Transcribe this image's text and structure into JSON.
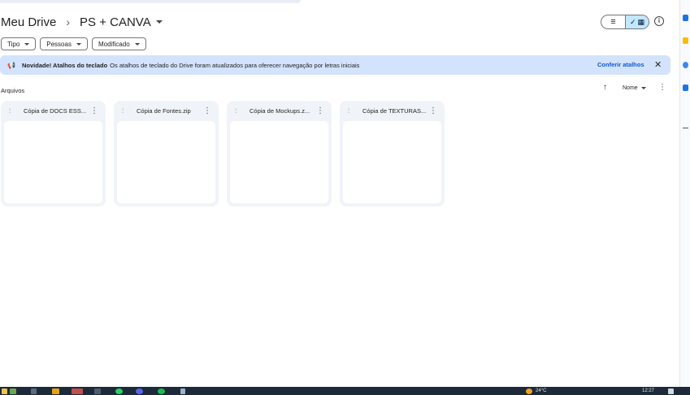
{
  "breadcrumb": {
    "root": "Meu Drive",
    "separator": "›",
    "current": "PS + CANVA"
  },
  "view_toggle": {
    "list_icon": "list-icon",
    "grid_icon": "grid-icon",
    "check_glyph": "✓",
    "list_glyph": "≡",
    "grid_glyph": "▦"
  },
  "info": {
    "glyph": "i"
  },
  "filters": [
    {
      "label": "Tipo"
    },
    {
      "label": "Pessoas"
    },
    {
      "label": "Modificado"
    }
  ],
  "banner": {
    "title": "Novidade! Atalhos do teclado",
    "text": "Os atalhos de teclado do Drive foram atualizados para oferecer navegação por letras iniciais",
    "link": "Conferir atalhos",
    "close": "✕"
  },
  "files_section": {
    "title": "Arquivos",
    "sort_label": "Nome",
    "sort_arrow": "↑",
    "more": "⋮"
  },
  "files": [
    {
      "name": "Cópia de DOCS ESS..."
    },
    {
      "name": "Cópia de Fontes.zip"
    },
    {
      "name": "Cópia de Mockups.z..."
    },
    {
      "name": "Cópia de TEXTURAS..."
    }
  ],
  "taskbar": {
    "weather": "24°C",
    "time": "12:27"
  },
  "colors": {
    "banner_bg": "#d3e3fd",
    "link": "#0b57d0",
    "toggle_active": "#c2e7ff",
    "card_bg": "#f0f4f9"
  }
}
